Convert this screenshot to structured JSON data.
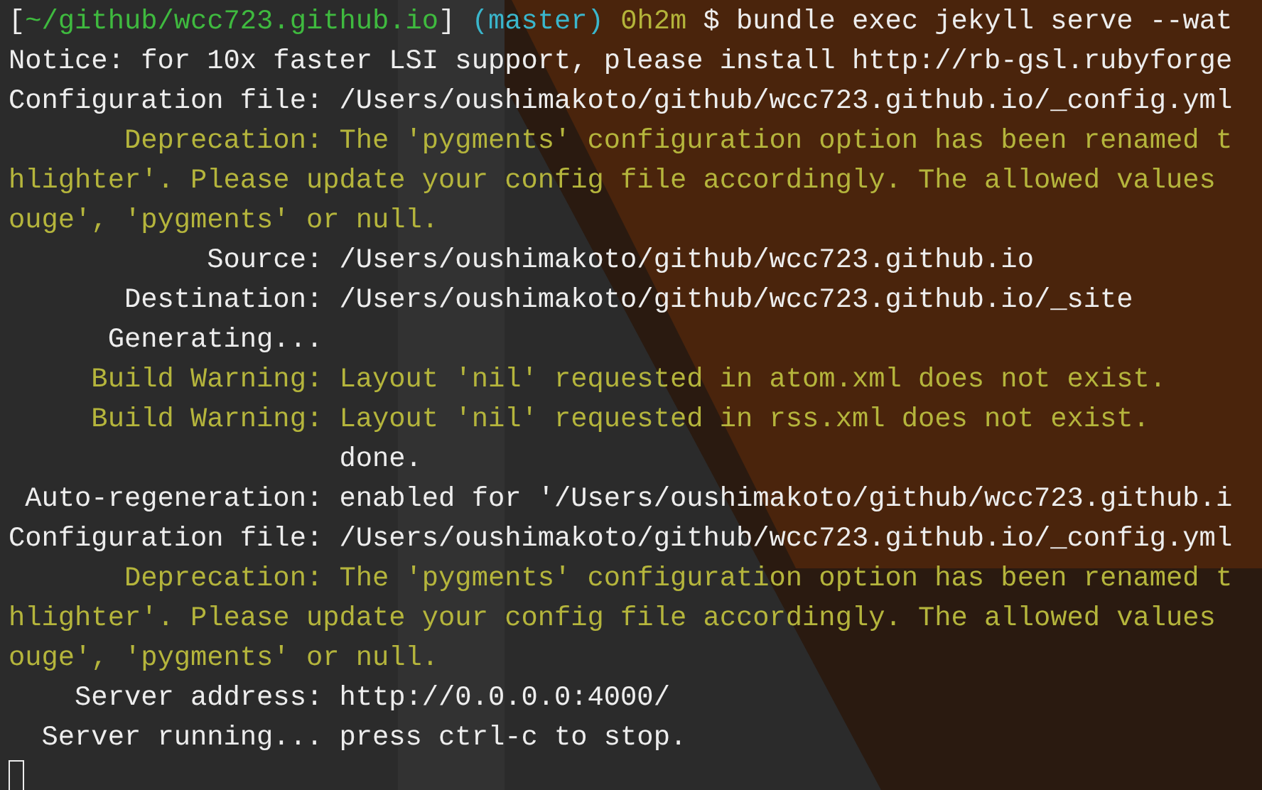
{
  "terminal": {
    "lines": [
      {
        "segments": [
          {
            "text": "[",
            "kind": "plain"
          },
          {
            "text": "~/github/wcc723.github.io",
            "kind": "path"
          },
          {
            "text": "] ",
            "kind": "plain"
          },
          {
            "text": "(master)",
            "kind": "branch"
          },
          {
            "text": " 0h2m",
            "kind": "time"
          },
          {
            "text": " $ bundle exec jekyll serve --wat",
            "kind": "plain"
          }
        ]
      },
      {
        "segments": [
          {
            "text": "Notice: for 10x faster LSI support, please install http://rb-gsl.rubyforge",
            "kind": "plain"
          }
        ]
      },
      {
        "segments": [
          {
            "text": "Configuration file: /Users/oushimakoto/github/wcc723.github.io/_config.yml",
            "kind": "plain"
          }
        ]
      },
      {
        "segments": [
          {
            "text": "       Deprecation: The 'pygments' configuration option has been renamed t",
            "kind": "warning"
          }
        ]
      },
      {
        "segments": [
          {
            "text": "hlighter'. Please update your config file accordingly. The allowed values",
            "kind": "warning"
          }
        ]
      },
      {
        "segments": [
          {
            "text": "ouge', 'pygments' or null.",
            "kind": "warning"
          }
        ]
      },
      {
        "segments": [
          {
            "text": "            Source: /Users/oushimakoto/github/wcc723.github.io",
            "kind": "plain"
          }
        ]
      },
      {
        "segments": [
          {
            "text": "       Destination: /Users/oushimakoto/github/wcc723.github.io/_site",
            "kind": "plain"
          }
        ]
      },
      {
        "segments": [
          {
            "text": "      Generating...",
            "kind": "plain"
          }
        ]
      },
      {
        "segments": [
          {
            "text": "     Build Warning:",
            "kind": "warning"
          },
          {
            "text": " Layout 'nil' requested in atom.xml does not exist.",
            "kind": "warning"
          }
        ]
      },
      {
        "segments": [
          {
            "text": "     Build Warning:",
            "kind": "warning"
          },
          {
            "text": " Layout 'nil' requested in rss.xml does not exist.",
            "kind": "warning"
          }
        ]
      },
      {
        "segments": [
          {
            "text": "                    done.",
            "kind": "plain"
          }
        ]
      },
      {
        "segments": [
          {
            "text": " Auto-regeneration: enabled for '/Users/oushimakoto/github/wcc723.github.i",
            "kind": "plain"
          }
        ]
      },
      {
        "segments": [
          {
            "text": "Configuration file: /Users/oushimakoto/github/wcc723.github.io/_config.yml",
            "kind": "plain"
          }
        ]
      },
      {
        "segments": [
          {
            "text": "       Deprecation: The 'pygments' configuration option has been renamed t",
            "kind": "warning"
          }
        ]
      },
      {
        "segments": [
          {
            "text": "hlighter'. Please update your config file accordingly. The allowed values",
            "kind": "warning"
          }
        ]
      },
      {
        "segments": [
          {
            "text": "ouge', 'pygments' or null.",
            "kind": "warning"
          }
        ]
      },
      {
        "segments": [
          {
            "text": "    Server address: http://0.0.0.0:4000/",
            "kind": "plain"
          }
        ]
      },
      {
        "segments": [
          {
            "text": "  Server running... press ctrl-c to stop.",
            "kind": "plain"
          }
        ]
      }
    ]
  }
}
